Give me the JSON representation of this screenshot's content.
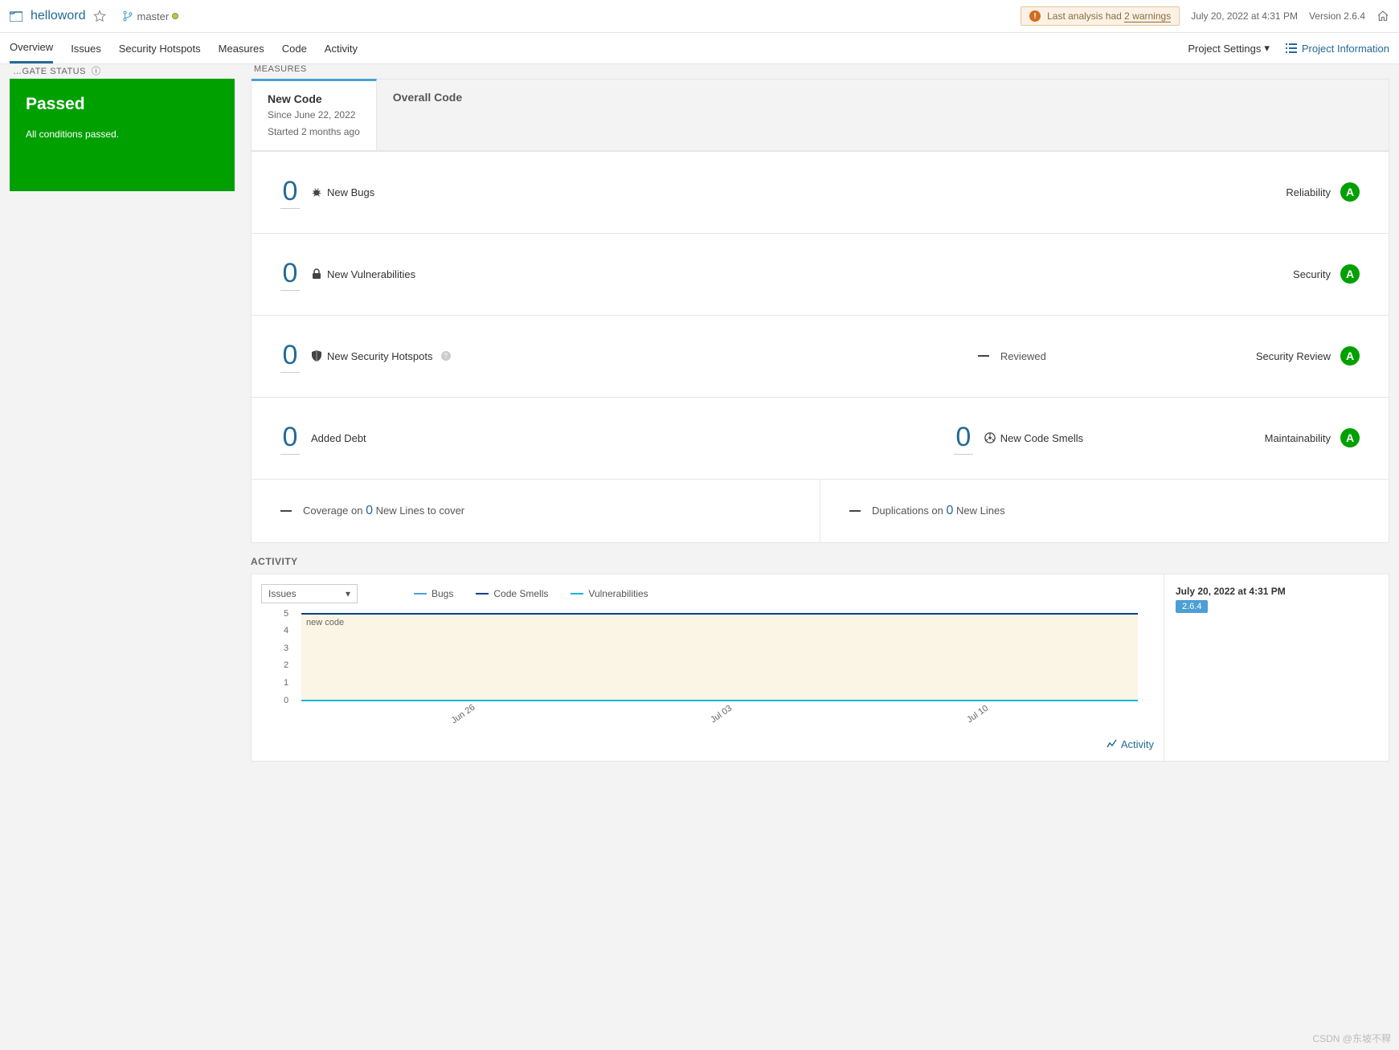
{
  "header": {
    "project_name": "helloword",
    "branch": "master",
    "warning_prefix": "Last analysis had ",
    "warning_link": "2 warnings",
    "analysis_date": "July 20, 2022 at 4:31 PM",
    "version": "Version 2.6.4"
  },
  "nav": {
    "overview": "Overview",
    "issues": "Issues",
    "security_hotspots": "Security Hotspots",
    "measures": "Measures",
    "code": "Code",
    "activity": "Activity",
    "project_settings": "Project Settings",
    "project_info": "Project Information"
  },
  "quality_gate": {
    "status": "Passed",
    "message": "All conditions passed."
  },
  "section_titles": {
    "gate": "QUALITY GATE STATUS",
    "measures": "MEASURES",
    "activity": "ACTIVITY"
  },
  "tabs": {
    "new_code": "New Code",
    "since": "Since June 22, 2022",
    "started": "Started 2 months ago",
    "overall": "Overall Code"
  },
  "metrics": {
    "bugs_val": "0",
    "bugs_label": "New Bugs",
    "reliability": "Reliability",
    "vuln_val": "0",
    "vuln_label": "New Vulnerabilities",
    "security": "Security",
    "hotspots_val": "0",
    "hotspots_label": "New Security Hotspots",
    "reviewed": "Reviewed",
    "security_review": "Security Review",
    "debt_val": "0",
    "debt_label": "Added Debt",
    "smells_val": "0",
    "smells_label": "New Code Smells",
    "maintainability": "Maintainability",
    "rating": "A",
    "coverage_prefix": "Coverage on ",
    "coverage_zero": "0",
    "coverage_suffix": " New Lines to cover",
    "dup_prefix": "Duplications on ",
    "dup_zero": "0",
    "dup_suffix": " New Lines"
  },
  "activity": {
    "dropdown": "Issues",
    "legend_bugs": "Bugs",
    "legend_smells": "Code Smells",
    "legend_vuln": "Vulnerabilities",
    "new_code_label": "new code",
    "link": "Activity",
    "side_date": "July 20, 2022 at 4:31 PM",
    "side_version": "2.6.4"
  },
  "chart_data": {
    "type": "line",
    "y_ticks": [
      "5",
      "4",
      "3",
      "2",
      "1",
      "0"
    ],
    "x_ticks": [
      "Jun 26",
      "Jul 03",
      "Jul 10"
    ],
    "series": [
      {
        "name": "Bugs",
        "color": "#4b9fd5",
        "values": [
          0,
          0,
          0
        ]
      },
      {
        "name": "Code Smells",
        "color": "#094183",
        "values": [
          5,
          5,
          5
        ]
      },
      {
        "name": "Vulnerabilities",
        "color": "#06b8d6",
        "values": [
          0,
          0,
          0
        ]
      }
    ],
    "ylim": [
      0,
      5
    ]
  },
  "watermark": "CSDN @东坡不稈"
}
